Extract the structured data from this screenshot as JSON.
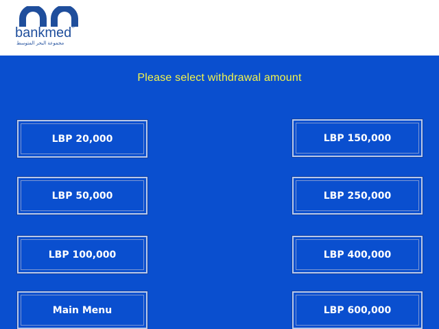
{
  "brand": {
    "name": "bankmed",
    "registered": "®",
    "arabic_tagline": "مجموعة البحر المتوسط"
  },
  "screen": {
    "prompt": "Please select withdrawal amount"
  },
  "left_options": [
    {
      "label": "LBP 20,000"
    },
    {
      "label": "LBP 50,000"
    },
    {
      "label": "LBP 100,000"
    },
    {
      "label": "Main Menu"
    }
  ],
  "right_options": [
    {
      "label": "LBP 150,000"
    },
    {
      "label": "LBP 250,000"
    },
    {
      "label": "LBP 400,000"
    },
    {
      "label": "LBP 600,000"
    }
  ],
  "colors": {
    "background": "#0a4fcf",
    "prompt_text": "#f4f44a",
    "button_text": "#ffffff",
    "logo": "#1f4e9c"
  }
}
